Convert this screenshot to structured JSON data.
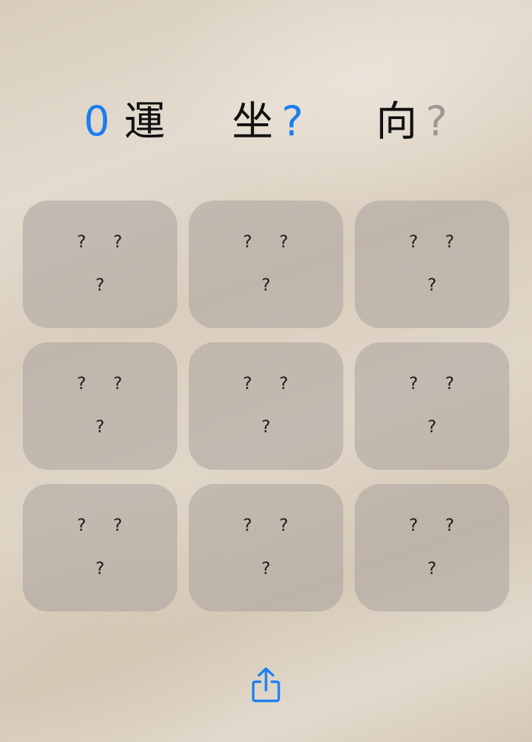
{
  "header": {
    "stats": [
      {
        "value": "0",
        "label": "運"
      },
      {
        "label": "坐",
        "value": "?"
      },
      {
        "label": "向",
        "value": "?"
      }
    ]
  },
  "grid": {
    "cells": [
      {
        "marks": [
          "?",
          "?",
          "?"
        ]
      },
      {
        "marks": [
          "?",
          "?",
          "?"
        ]
      },
      {
        "marks": [
          "?",
          "?",
          "?"
        ]
      },
      {
        "marks": [
          "?",
          "?",
          "?"
        ]
      },
      {
        "marks": [
          "?",
          "?",
          "?"
        ]
      },
      {
        "marks": [
          "?",
          "?",
          "?"
        ]
      },
      {
        "marks": [
          "?",
          "?",
          "?"
        ]
      },
      {
        "marks": [
          "?",
          "?",
          "?"
        ]
      },
      {
        "marks": [
          "?",
          "?",
          "?"
        ]
      }
    ]
  },
  "footer": {
    "share_icon": "share-icon"
  },
  "colors": {
    "accent": "#1a7ef0",
    "muted": "#9c9894",
    "tile": "#aaa29c"
  }
}
